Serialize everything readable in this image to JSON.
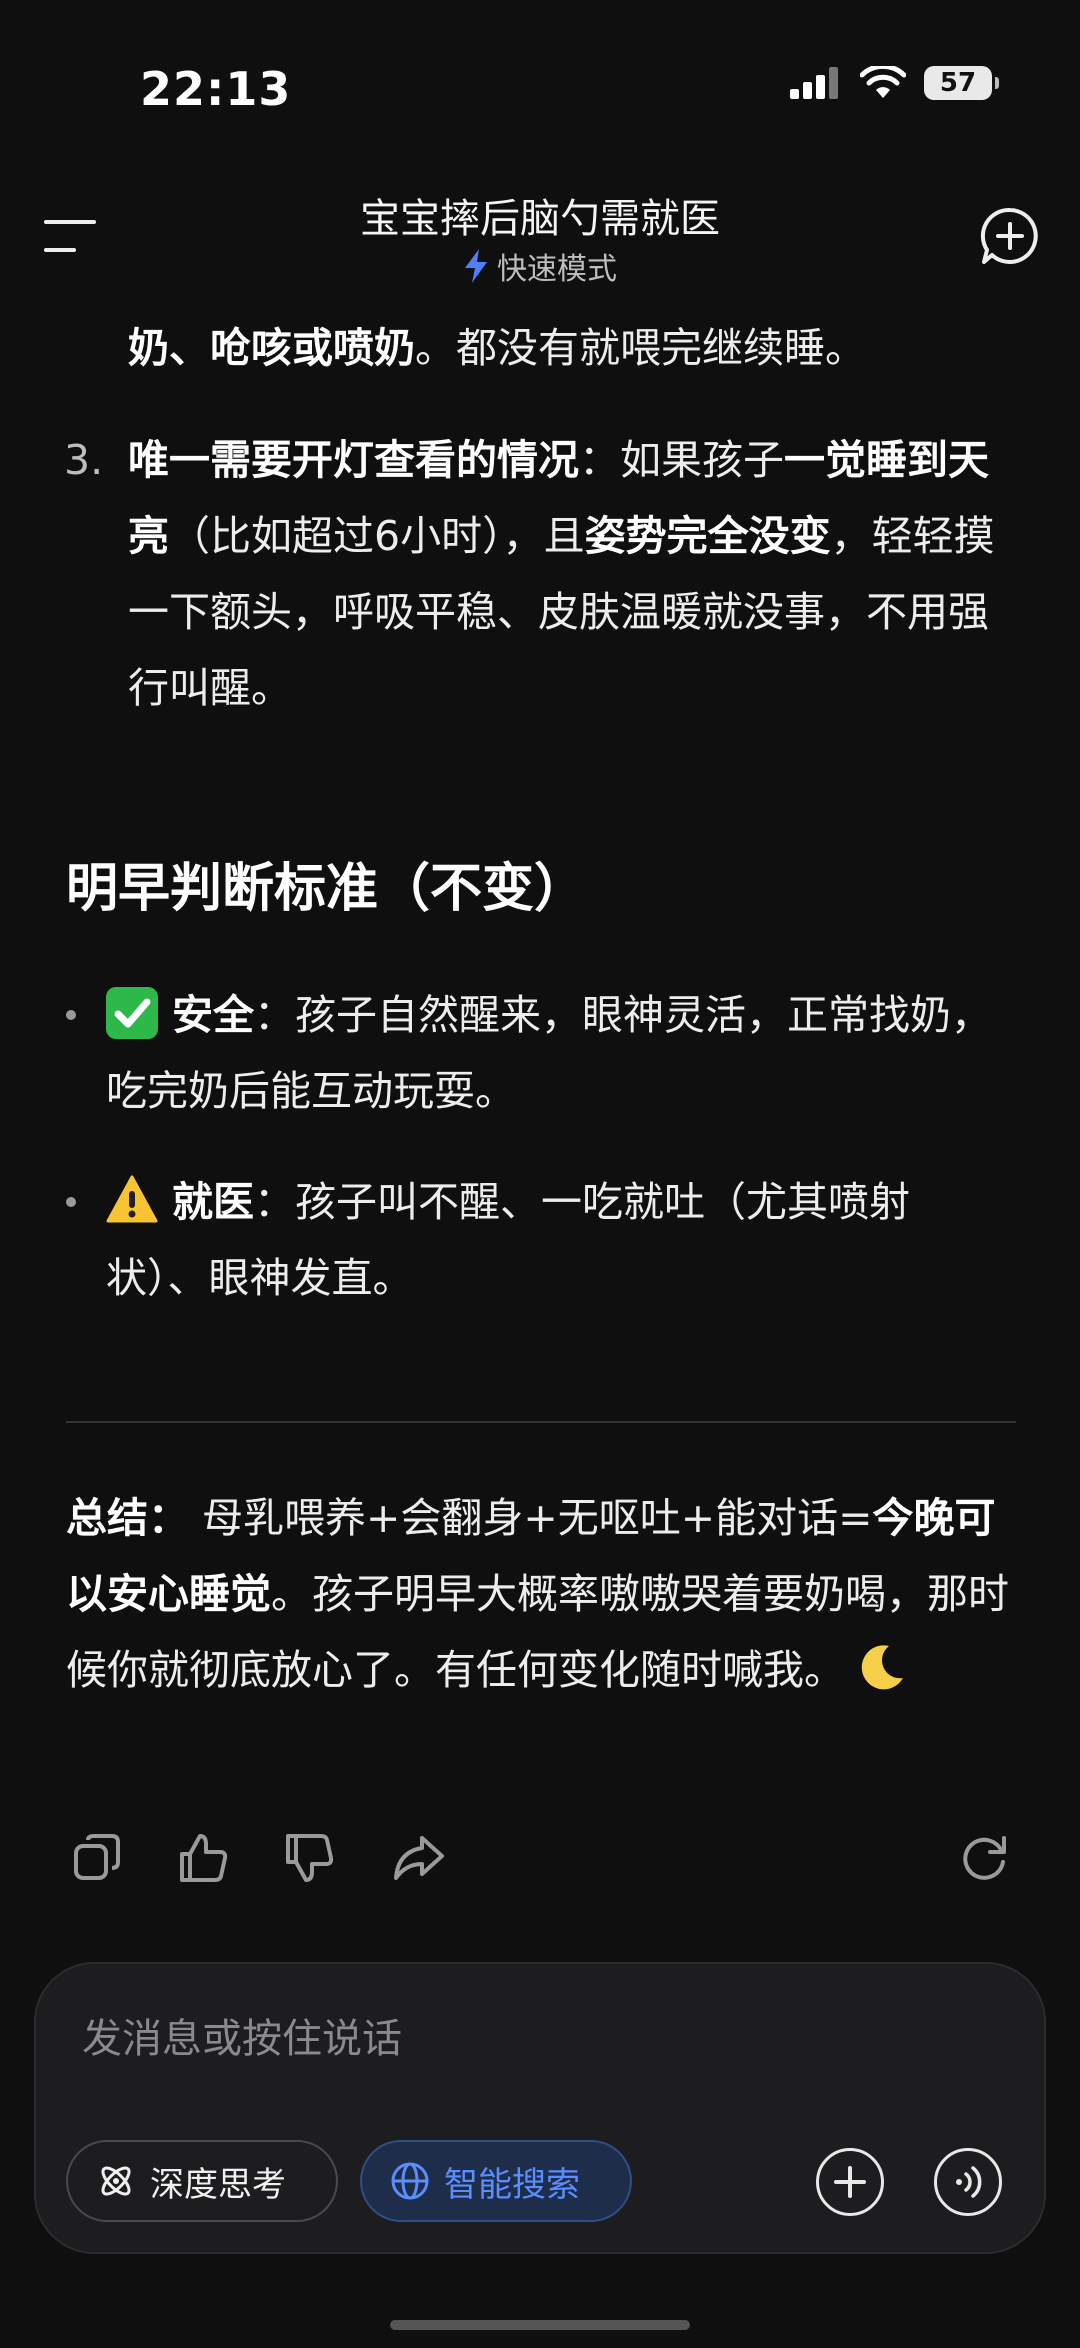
{
  "status_bar": {
    "time": "22:13",
    "battery": "57",
    "icons": [
      "signal-icon",
      "wifi-icon",
      "battery-icon"
    ]
  },
  "header": {
    "title": "宝宝摔后脑勺需就医",
    "mode": "快速模式",
    "menu_icon": "menu-icon",
    "new_chat_icon": "new-chat-icon"
  },
  "content": {
    "top_line": {
      "bold": "奶、呛咳或喷奶",
      "rest": "。都没有就喂完继续睡。"
    },
    "item3": {
      "num": "3.",
      "bold1": "唯一需要开灯查看的情况",
      "t1": "：如果孩子",
      "bold2": "一觉睡到天亮",
      "t2": "（比如超过6小时），且",
      "bold3": "姿势完全没变",
      "t3": "，轻轻摸一下额头，呼吸平稳、皮肤温暖就没事，不用强行叫醒。"
    },
    "section_title": "明早判断标准（不变）",
    "bullets": [
      {
        "emoji": "check-icon",
        "bold": "安全",
        "text": "：孩子自然醒来，眼神灵活，正常找奶，吃完奶后能互动玩耍。"
      },
      {
        "emoji": "warning-icon",
        "bold": "就医",
        "text": "：孩子叫不醒、一吃就吐（尤其喷射状）、眼神发直。"
      }
    ],
    "summary": {
      "label": "总结：",
      "t1": " 母乳喂养+会翻身+无呕吐+能对话=",
      "bold": "今晚可以安心睡觉",
      "t2": "。孩子明早大概率嗷嗷哭着要奶喝，那时候你就彻底放心了。有任何变化随时喊我。",
      "emoji": "moon-icon"
    }
  },
  "actions": [
    "copy-icon",
    "thumbs-up-icon",
    "thumbs-down-icon",
    "share-icon",
    "regenerate-icon"
  ],
  "composer": {
    "placeholder": "发消息或按住说话",
    "deep_think": "深度思考",
    "smart_search": "智能搜索",
    "colors": {
      "search_accent": "#5b8dff",
      "search_bg": "#1e2d4a"
    }
  }
}
